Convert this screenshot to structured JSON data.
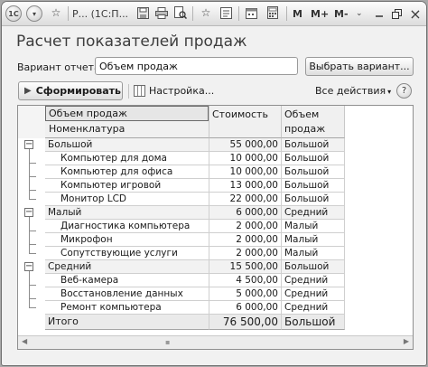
{
  "titlebar": {
    "logo": "1С",
    "title": "Р...  (1С:П...",
    "icons": [
      "dropdown-icon",
      "star-icon",
      "save-icon",
      "print-icon",
      "preview-icon",
      "favorite-add-icon",
      "history-icon",
      "calendar-icon",
      "calculator-icon"
    ],
    "m_label": "M",
    "m_plus_label": "M+",
    "m_minus_label": "M-",
    "close_glyph": "×"
  },
  "heading": "Расчет показателей продаж",
  "variant": {
    "label": "Вариант отчета:",
    "value": "Объем продаж",
    "choose_label": "Выбрать вариант..."
  },
  "toolbar": {
    "form_label": "Сформировать",
    "settings_label": "Настройка...",
    "all_actions_label": "Все действия",
    "help_glyph": "?"
  },
  "report": {
    "headers": {
      "name_top": "Объем продаж",
      "name_bottom": "Номенклатура",
      "cost": "Стоимость",
      "volume_line1": "Объем",
      "volume_line2": "продаж"
    },
    "rows": [
      {
        "name": "Большой",
        "cost": "55 000,00",
        "volume": "Большой"
      },
      {
        "name": "Компьютер для дома",
        "cost": "10 000,00",
        "volume": "Большой"
      },
      {
        "name": "Компьютер для офиса",
        "cost": "10 000,00",
        "volume": "Большой"
      },
      {
        "name": "Компьютер игровой",
        "cost": "13 000,00",
        "volume": "Большой"
      },
      {
        "name": "Монитор LCD",
        "cost": "22 000,00",
        "volume": "Большой"
      },
      {
        "name": "Малый",
        "cost": "6 000,00",
        "volume": "Средний"
      },
      {
        "name": "Диагностика компьютера",
        "cost": "2 000,00",
        "volume": "Малый"
      },
      {
        "name": "Микрофон",
        "cost": "2 000,00",
        "volume": "Малый"
      },
      {
        "name": "Сопутствующие услуги",
        "cost": "2 000,00",
        "volume": "Малый"
      },
      {
        "name": "Средний",
        "cost": "15 500,00",
        "volume": "Большой"
      },
      {
        "name": "Веб-камера",
        "cost": "4 500,00",
        "volume": "Средний"
      },
      {
        "name": "Восстановление данных",
        "cost": "5 000,00",
        "volume": "Средний"
      },
      {
        "name": "Ремонт компьютера",
        "cost": "6 000,00",
        "volume": "Средний"
      }
    ],
    "total": {
      "name": "Итого",
      "cost": "76 500,00",
      "volume": "Большой"
    }
  }
}
